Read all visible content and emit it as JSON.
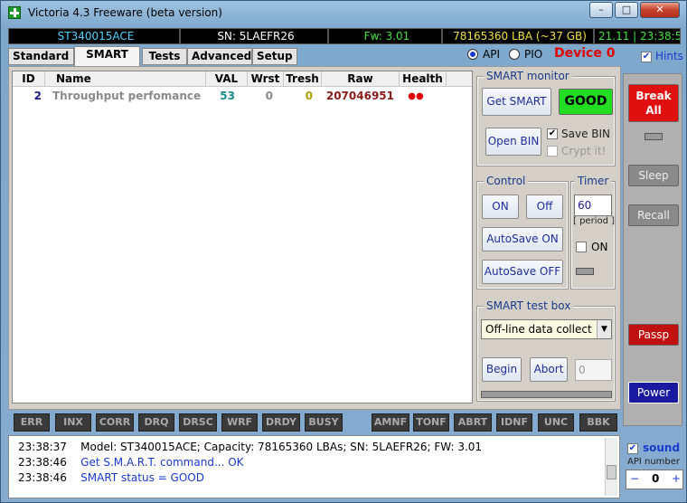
{
  "window": {
    "title": "Victoria 4.3 Freeware (beta version)",
    "minimize": "–",
    "maximize": "□",
    "close": "✕"
  },
  "info_bar": {
    "model": "ST340015ACE",
    "serial": "SN: 5LAEFR26",
    "firmware": "Fw: 3.01",
    "lba": "78165360 LBA (~37 GB)",
    "clock": "21.11 | 23:38:5"
  },
  "mode": {
    "api": "API",
    "pio": "PIO",
    "device": "Device 0",
    "hints": "Hints",
    "selected": "API"
  },
  "tabs": [
    {
      "label": "Standard",
      "active": false
    },
    {
      "label": "SMART",
      "active": true
    },
    {
      "label": "Tests",
      "active": false
    },
    {
      "label": "Advanced",
      "active": false
    },
    {
      "label": "Setup",
      "active": false
    }
  ],
  "grid": {
    "headers": [
      "ID",
      "Name",
      "VAL",
      "Wrst",
      "Tresh",
      "Raw",
      "Health"
    ],
    "rows": [
      {
        "id": "2",
        "name": "Throughput perfomance",
        "val": "53",
        "wrst": "0",
        "tresh": "0",
        "raw": "207046951",
        "health": "●●"
      }
    ]
  },
  "smart_monitor": {
    "label": "SMART monitor",
    "get_smart": "Get SMART",
    "status": "GOOD",
    "open_bin": "Open BIN",
    "save_bin": "Save BIN",
    "crypt": "Crypt it!"
  },
  "control": {
    "label": "Control",
    "on": "ON",
    "off": "Off",
    "autosave_on": "AutoSave ON",
    "autosave_off": "AutoSave OFF"
  },
  "timer": {
    "label": "Timer",
    "value": "60",
    "period": "[ period ]",
    "on": "ON"
  },
  "test_box": {
    "label": "SMART test box",
    "selected": "Off-line data collect",
    "begin": "Begin",
    "abort": "Abort",
    "value": "0"
  },
  "side": {
    "break_all": "Break All",
    "sleep": "Sleep",
    "recall": "Recall",
    "passp": "Passp",
    "power": "Power",
    "sound": "sound",
    "api_number": "API number",
    "api_value": "0",
    "minus": "−",
    "plus": "+"
  },
  "status_flags": [
    "ERR",
    "INX",
    "CORR",
    "DRQ",
    "DRSC",
    "WRF",
    "DRDY",
    "BUSY",
    "AMNF",
    "TONF",
    "ABRT",
    "IDNF",
    "UNC",
    "BBK"
  ],
  "log": [
    {
      "time": "23:38:37",
      "text": "Model: ST340015ACE; Capacity: 78165360 LBAs; SN: 5LAEFR26; FW: 3.01",
      "color": "#000000"
    },
    {
      "time": "23:38:46",
      "text": "Get S.M.A.R.T. command... OK",
      "color": "#1a3ad0"
    },
    {
      "time": "23:38:46",
      "text": "SMART status = GOOD",
      "color": "#1a3ad0"
    }
  ],
  "colors": {
    "good": "#22dd22",
    "device": "#e00000",
    "break": "#e01010",
    "passp": "#c01010",
    "power": "#1a1aa0"
  }
}
